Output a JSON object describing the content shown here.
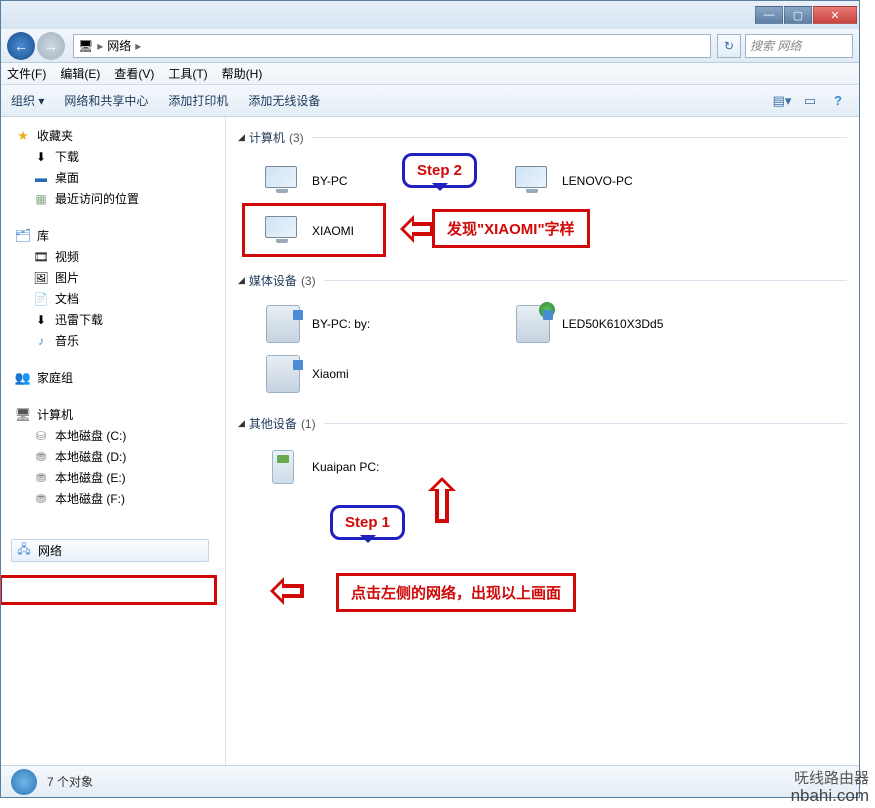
{
  "titlebar": {
    "min": "—",
    "max": "▢",
    "close": "✕"
  },
  "nav": {
    "back_glyph": "←",
    "fwd_glyph": "→",
    "breadcrumb_root_icon": "🖥",
    "breadcrumb_label": "网络",
    "refresh_glyph": "↻",
    "search_placeholder": "搜索 网络"
  },
  "menus": [
    "文件(F)",
    "编辑(E)",
    "查看(V)",
    "工具(T)",
    "帮助(H)"
  ],
  "toolbar": {
    "organize": "组织",
    "dropdown_glyph": "▾",
    "sharecenter": "网络和共享中心",
    "addprinter": "添加打印机",
    "addwireless": "添加无线设备",
    "view_glyph": "▤",
    "preview_glyph": "▭",
    "help_glyph": "?"
  },
  "sidebar": {
    "favorites": {
      "label": "收藏夹",
      "items": [
        "下载",
        "桌面",
        "最近访问的位置"
      ]
    },
    "library": {
      "label": "库",
      "items": [
        "视频",
        "图片",
        "文档",
        "迅雷下载",
        "音乐"
      ]
    },
    "homegroup": {
      "label": "家庭组"
    },
    "computer": {
      "label": "计算机",
      "drives": [
        "本地磁盘 (C:)",
        "本地磁盘 (D:)",
        "本地磁盘 (E:)",
        "本地磁盘 (F:)"
      ]
    },
    "network": {
      "label": "网络"
    }
  },
  "content": {
    "groups": [
      {
        "name": "计算机",
        "count": "(3)",
        "items": [
          "BY-PC",
          "LENOVO-PC",
          "XIAOMI"
        ]
      },
      {
        "name": "媒体设备",
        "count": "(3)",
        "items": [
          "BY-PC: by:",
          "LED50K610X3Dd5",
          "Xiaomi"
        ]
      },
      {
        "name": "其他设备",
        "count": "(1)",
        "items": [
          "Kuaipan PC:"
        ]
      }
    ]
  },
  "annotations": {
    "step1": "Step 1",
    "step2": "Step 2",
    "found_xiaomi": "发现\"XIAOMI\"字样",
    "click_network": "点击左侧的网络，出现以上画面"
  },
  "status": {
    "text": "7 个对象"
  },
  "watermark": {
    "cn": "呒线路由器",
    "en": "nbahi.com"
  }
}
